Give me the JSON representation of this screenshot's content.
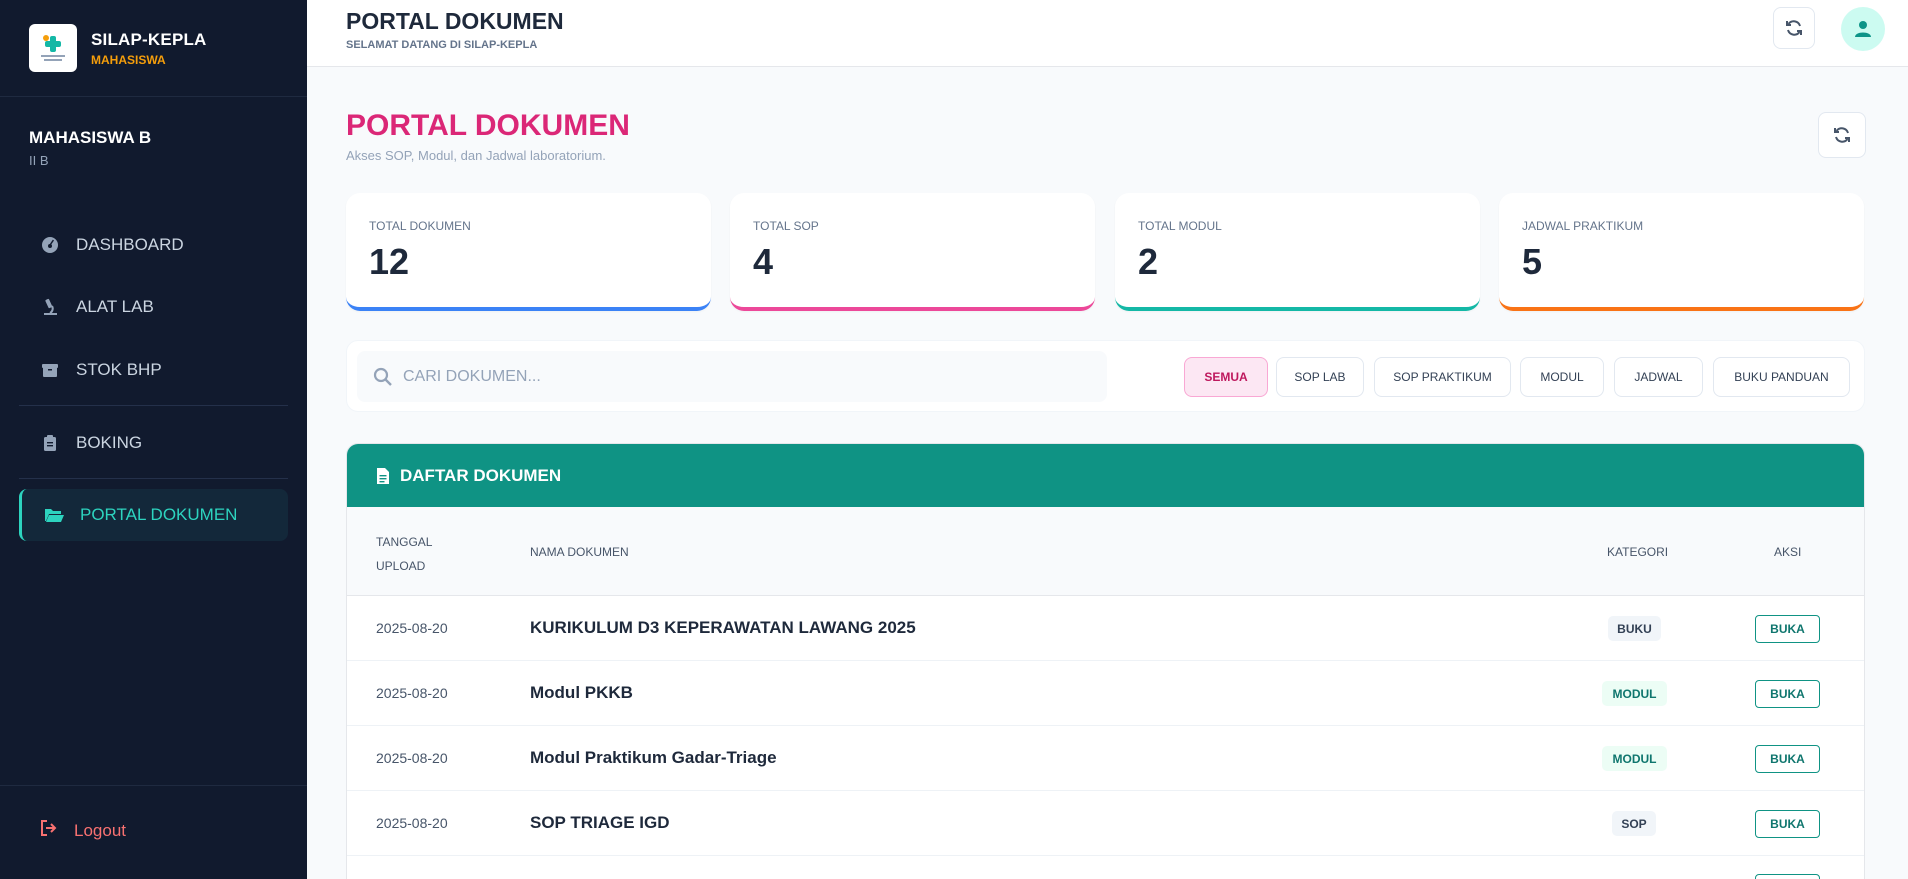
{
  "brand": {
    "name": "SILAP-KEPLA",
    "role": "MAHASISWA"
  },
  "user": {
    "name": "MAHASISWA B",
    "class": "II B"
  },
  "nav": [
    {
      "label": "DASHBOARD",
      "icon": "dashboard-icon"
    },
    {
      "label": "ALAT LAB",
      "icon": "microscope-icon"
    },
    {
      "label": "STOK BHP",
      "icon": "box-icon"
    },
    {
      "label": "BOKING",
      "icon": "clipboard-icon"
    },
    {
      "label": "PORTAL DOKUMEN",
      "icon": "folder-open-icon",
      "active": true
    }
  ],
  "logout": {
    "label": "Logout"
  },
  "topbar": {
    "title": "PORTAL DOKUMEN",
    "subtitle": "SELAMAT DATANG DI SILAP-KEPLA"
  },
  "page": {
    "title": "PORTAL DOKUMEN",
    "subtitle": "Akses SOP, Modul, dan Jadwal laboratorium."
  },
  "stats": [
    {
      "label": "TOTAL DOKUMEN",
      "value": "12",
      "color": "#3b82f6"
    },
    {
      "label": "TOTAL SOP",
      "value": "4",
      "color": "#ec4899"
    },
    {
      "label": "TOTAL MODUL",
      "value": "2",
      "color": "#14b8a6"
    },
    {
      "label": "JADWAL PRAKTIKUM",
      "value": "5",
      "color": "#f97316"
    }
  ],
  "search": {
    "placeholder": "CARI DOKUMEN...",
    "value": ""
  },
  "filters": [
    "SEMUA",
    "SOP LAB",
    "SOP PRAKTIKUM",
    "MODUL",
    "JADWAL",
    "BUKU PANDUAN"
  ],
  "table": {
    "title": "DAFTAR DOKUMEN",
    "columns": {
      "date_line1": "TANGGAL",
      "date_line2": "UPLOAD",
      "name": "NAMA DOKUMEN",
      "category": "KATEGORI",
      "action": "AKSI"
    },
    "rows": [
      {
        "date": "2025-08-20",
        "name": "KURIKULUM D3 KEPERAWATAN LAWANG 2025",
        "category": "BUKU",
        "action": "BUKA"
      },
      {
        "date": "2025-08-20",
        "name": "Modul PKKB",
        "category": "MODUL",
        "action": "BUKA"
      },
      {
        "date": "2025-08-20",
        "name": "Modul Praktikum Gadar-Triage",
        "category": "MODUL",
        "action": "BUKA"
      },
      {
        "date": "2025-08-20",
        "name": "SOP TRIAGE IGD",
        "category": "SOP",
        "action": "BUKA"
      }
    ]
  }
}
